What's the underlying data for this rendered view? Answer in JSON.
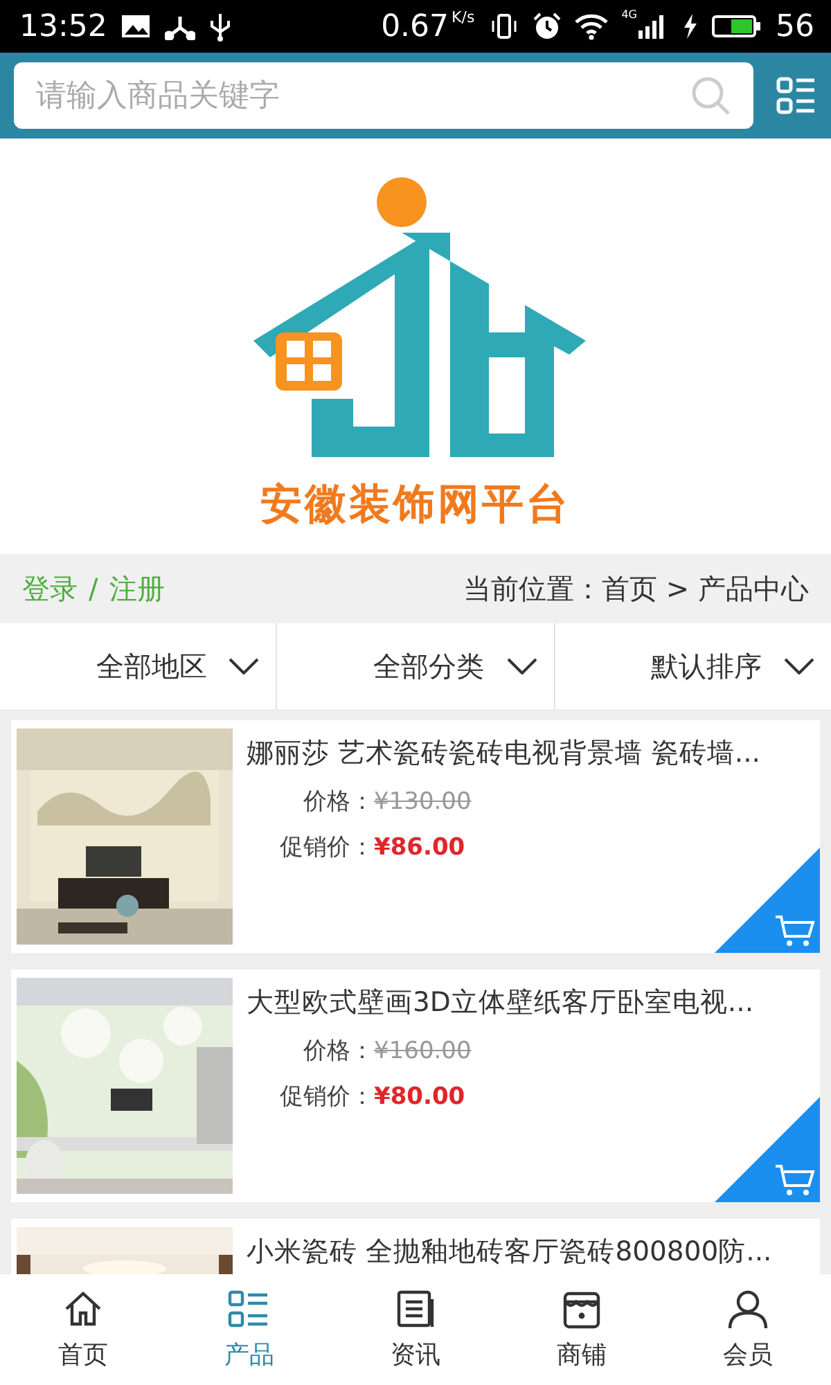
{
  "status_bar": {
    "time": "13:52",
    "speed": "0.67",
    "speed_unit": "K/s",
    "network": "4G",
    "battery": "56"
  },
  "search": {
    "placeholder": "请输入商品关键字"
  },
  "banner": {
    "title": "安徽装饰网平台"
  },
  "account": {
    "login": "登录",
    "separator": "/",
    "register": "注册"
  },
  "breadcrumb": "当前位置：首页 > 产品中心",
  "filters": [
    {
      "label": "全部地区"
    },
    {
      "label": "全部分类"
    },
    {
      "label": "默认排序"
    }
  ],
  "products": [
    {
      "title": "娜丽莎 艺术瓷砖瓷砖电视背景墙 瓷砖墙...",
      "price_label": "价格：",
      "price": "¥130.00",
      "sale_label": "促销价：",
      "sale_price": "¥86.00"
    },
    {
      "title": "大型欧式壁画3D立体壁纸客厅卧室电视...",
      "price_label": "价格：",
      "price": "¥160.00",
      "sale_label": "促销价：",
      "sale_price": "¥80.00"
    },
    {
      "title": "小米瓷砖 全抛釉地砖客厅瓷砖800800防..."
    }
  ],
  "tabs": [
    {
      "label": "首页",
      "selected": false
    },
    {
      "label": "产品",
      "selected": true
    },
    {
      "label": "资讯",
      "selected": false
    },
    {
      "label": "商铺",
      "selected": false
    },
    {
      "label": "会员",
      "selected": false
    }
  ]
}
